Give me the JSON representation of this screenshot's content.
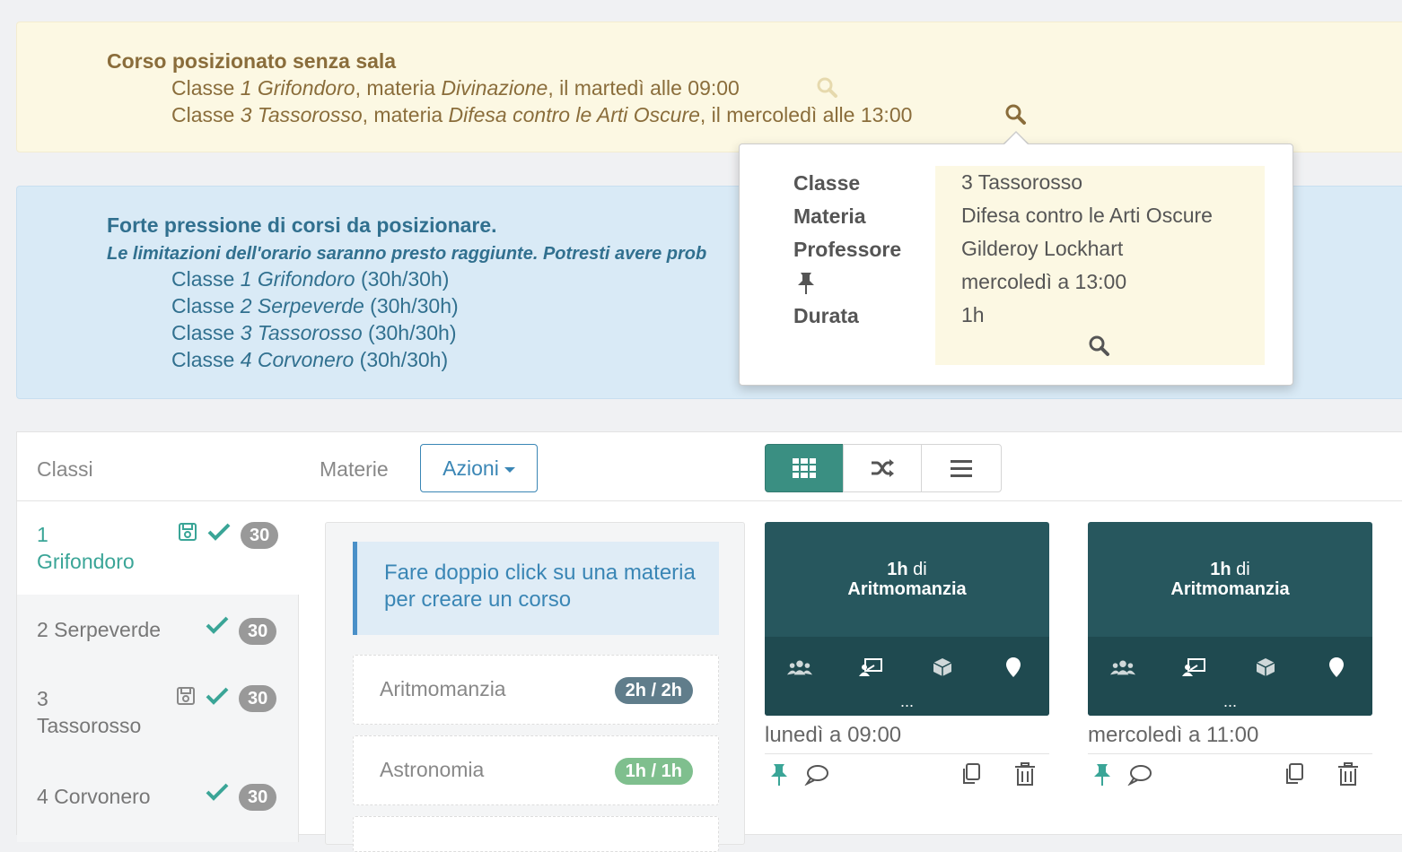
{
  "warning": {
    "title": "Corso posizionato senza sala",
    "lines": [
      {
        "c1": "Classe ",
        "c2": "1 Grifondoro",
        "c3": ", materia ",
        "c4": "Divinazione",
        "c5": ", il martedì alle 09:00"
      },
      {
        "c1": "Classe ",
        "c2": "3 Tassorosso",
        "c3": ", materia ",
        "c4": "Difesa contro le Arti Oscure",
        "c5": ", il mercoledì alle 13:00"
      }
    ]
  },
  "info": {
    "title": "Forte pressione di corsi da posizionare.",
    "subtitle": "Le limitazioni dell'orario saranno presto raggiunte. Potresti avere prob",
    "lines": [
      {
        "prefix": "Classe ",
        "name": "1 Grifondoro",
        "hours": " (30h/30h)"
      },
      {
        "prefix": "Classe ",
        "name": "2 Serpeverde",
        "hours": " (30h/30h)"
      },
      {
        "prefix": "Classe ",
        "name": "3 Tassorosso",
        "hours": " (30h/30h)"
      },
      {
        "prefix": "Classe ",
        "name": "4 Corvonero",
        "hours": " (30h/30h)"
      }
    ]
  },
  "popover": {
    "labels": {
      "classe": "Classe",
      "materia": "Materia",
      "professore": "Professore",
      "durata": "Durata"
    },
    "values": {
      "classe": "3 Tassorosso",
      "materia": "Difesa contro le Arti Oscure",
      "professore": "Gilderoy Lockhart",
      "pinned": "mercoledì a 13:00",
      "durata": "1h"
    }
  },
  "toolbar": {
    "classi": "Classi",
    "materie": "Materie",
    "azioni": "Azioni"
  },
  "classes": [
    {
      "line1": "1",
      "line2": "Grifondoro",
      "count": "30"
    },
    {
      "line1": "2 Serpeverde",
      "count": "30"
    },
    {
      "line1": "3",
      "line2": "Tassorosso",
      "count": "30"
    },
    {
      "line1": "4 Corvonero",
      "count": "30"
    }
  ],
  "materie": {
    "hint": "Fare doppio click su una materia per creare un corso",
    "subjects": [
      {
        "name": "Aritmomanzia",
        "hours": "2h / 2h"
      },
      {
        "name": "Astronomia",
        "hours": "1h / 1h"
      }
    ]
  },
  "cards": [
    {
      "hours": "1h",
      "of": " di",
      "subject": "Aritmomanzia",
      "dots": "...",
      "when": "lunedì a 09:00"
    },
    {
      "hours": "1h",
      "of": " di",
      "subject": "Aritmomanzia",
      "dots": "...",
      "when": "mercoledì a 11:00"
    }
  ],
  "colors": {
    "warning_bg": "#fcf8e3",
    "warning_text": "#8a6d3b",
    "info_bg": "#d9eaf6",
    "info_text": "#31708f",
    "accent": "#3aa597",
    "card_bg": "#27575e",
    "badge_dark": "#607d8b",
    "badge_green": "#7fbf8e"
  }
}
